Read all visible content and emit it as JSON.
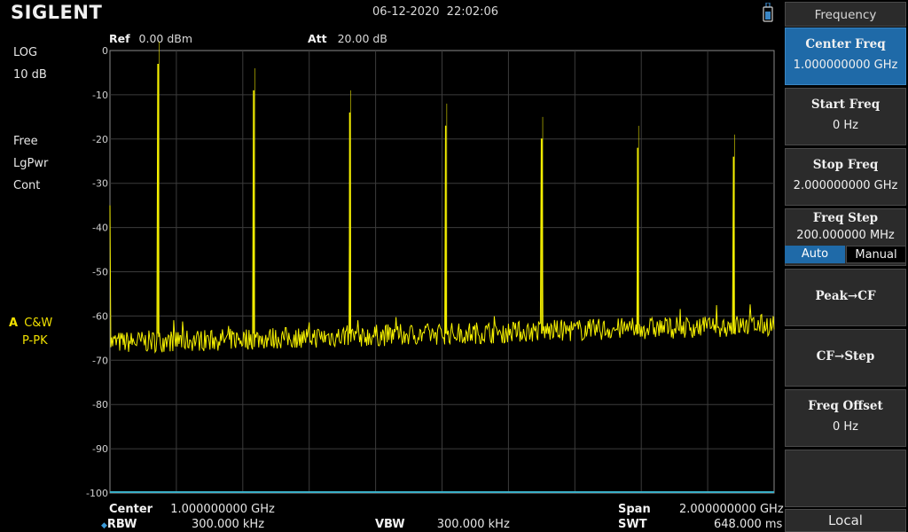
{
  "header": {
    "brand": "SIGLENT",
    "datetime": "06-12-2020   22:02:06",
    "ref_label": "Ref",
    "ref_value": "0.00 dBm",
    "att_label": "Att",
    "att_value": "20.00 dB"
  },
  "left_panel": {
    "scale_type": "LOG",
    "scale_div": "10 dB",
    "trigger": "Free",
    "detector": "LgPwr",
    "sweep_mode": "Cont",
    "trace_letter": "A",
    "trace_type": "C&W",
    "trace_detector": "P-PK"
  },
  "y_axis_ticks": [
    "0",
    "-10",
    "-20",
    "-30",
    "-40",
    "-50",
    "-60",
    "-70",
    "-80",
    "-90",
    "-100"
  ],
  "footer": {
    "center_label": "Center",
    "center_value": "1.000000000 GHz",
    "span_label": "Span",
    "span_value": "2.000000000 GHz",
    "rbw_label": "RBW",
    "rbw_value": "300.000 kHz",
    "vbw_label": "VBW",
    "vbw_value": "300.000 kHz",
    "swt_label": "SWT",
    "swt_value": "648.000 ms"
  },
  "softkeys": {
    "menu_title": "Frequency",
    "center_freq_label": "Center Freq",
    "center_freq_value": "1.000000000 GHz",
    "start_freq_label": "Start Freq",
    "start_freq_value": "0 Hz",
    "stop_freq_label": "Stop Freq",
    "stop_freq_value": "2.000000000 GHz",
    "freq_step_label": "Freq Step",
    "freq_step_value": "200.000000 MHz",
    "auto_label": "Auto",
    "manual_label": "Manual",
    "peak_cf_label": "Peak→CF",
    "cf_step_label": "CF→Step",
    "freq_offset_label": "Freq Offset",
    "freq_offset_value": "0 Hz",
    "local_label": "Local"
  },
  "colors": {
    "trace": "#f5f000",
    "grid": "#3c3c3c",
    "active_key": "#1f6aa8",
    "baseline": "#3ab0c8"
  },
  "chart_data": {
    "type": "line",
    "x_unit": "GHz",
    "xlim": [
      0,
      2
    ],
    "ylim": [
      -100,
      0
    ],
    "y_unit": "dBm",
    "grid": true,
    "noise_floor_start": -66,
    "noise_floor_end": -62,
    "peaks": [
      {
        "freq": 0.145,
        "level": -3
      },
      {
        "freq": 0.433,
        "level": -9
      },
      {
        "freq": 0.722,
        "level": -14
      },
      {
        "freq": 1.011,
        "level": -17
      },
      {
        "freq": 1.3,
        "level": -20
      },
      {
        "freq": 1.589,
        "level": -22
      },
      {
        "freq": 1.878,
        "level": -24
      }
    ]
  }
}
